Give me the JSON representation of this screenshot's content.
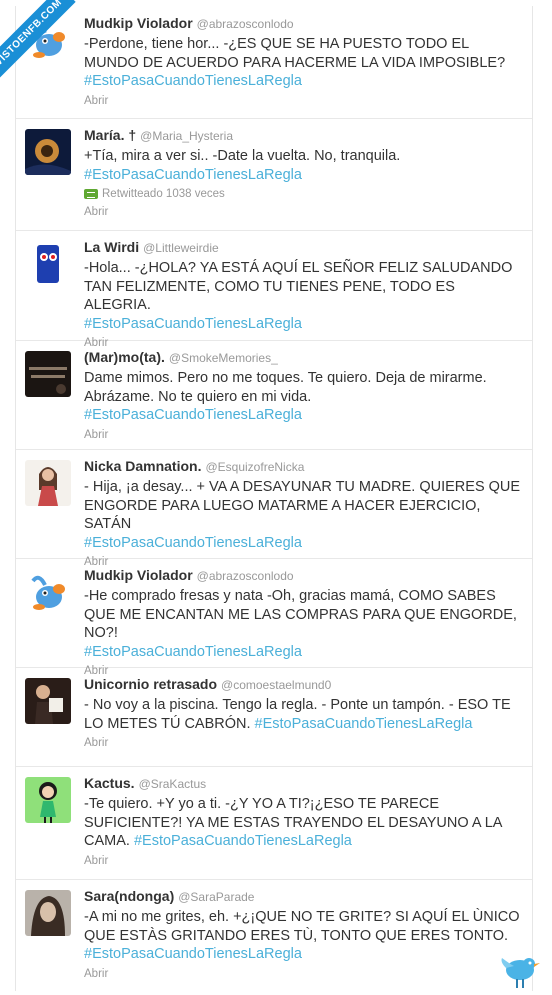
{
  "watermark": "VISTOENFB.COM",
  "tweets": [
    {
      "name": "Mudkip Violador",
      "handle": "@abrazosconlodo",
      "text": "-Perdone, tiene hor... -¿ES QUE SE HA PUESTO TODO EL MUNDO DE ACUERDO PARA HACERME LA VIDA IMPOSIBLE?",
      "hashtag": "#EstoPasaCuandoTienesLaRegla",
      "open": "Abrir"
    },
    {
      "name": "María. †",
      "handle": "@Maria_Hysteria",
      "text": "+Tía, mira a ver si.. -Date la vuelta. No, tranquila.",
      "hashtag": "#EstoPasaCuandoTienesLaRegla",
      "retweet": "Retwitteado 1038 veces",
      "open": "Abrir"
    },
    {
      "name": "La Wirdi",
      "handle": "@Littleweirdie",
      "text": "-Hola... -¿HOLA? YA ESTÁ AQUÍ EL SEÑOR FELIZ SALUDANDO TAN FELIZMENTE, COMO TU TIENES PENE, TODO ES ALEGRIA.",
      "hashtag": "#EstoPasaCuandoTienesLaRegla",
      "open": "Abrir"
    },
    {
      "name": "(Mar)mo(ta).",
      "handle": "@SmokeMemories_",
      "text": "Dame mimos. Pero no me toques. Te quiero. Deja de mirarme. Abrázame. No te quiero en mi vida.",
      "hashtag": "#EstoPasaCuandoTienesLaRegla",
      "open": "Abrir"
    },
    {
      "name": "Nicka Damnation.",
      "handle": "@EsquizofreNicka",
      "text": "- Hija, ¡a desay... + VA A DESAYUNAR TU MADRE. QUIERES QUE ENGORDE PARA LUEGO MATARME A HACER EJERCICIO, SATÁN",
      "hashtag": "#EstoPasaCuandoTienesLaRegla",
      "open": "Abrir"
    },
    {
      "name": "Mudkip Violador",
      "handle": "@abrazosconlodo",
      "text": "-He comprado fresas y nata -Oh, gracias mamá, COMO SABES QUE ME ENCANTAN ME LAS COMPRAS PARA QUE ENGORDE, NO?!",
      "hashtag": "#EstoPasaCuandoTienesLaRegla",
      "open": "Abrir"
    },
    {
      "name": "Unicornio retrasado",
      "handle": "@comoestaelmund0",
      "text": "- No voy a la piscina. Tengo la regla. - Ponte un tampón. - ESO TE LO METES TÚ CABRÓN.",
      "hashtag": "#EstoPasaCuandoTienesLaRegla",
      "open": "Abrir"
    },
    {
      "name": "Kactus.",
      "handle": "@SraKactus",
      "text": "-Te quiero. +Y yo a ti. -¿Y YO A TI?¡¿ESO TE PARECE SUFICIENTE?! YA ME ESTAS TRAYENDO EL DESAYUNO A LA CAMA.",
      "hashtag": "#EstoPasaCuandoTienesLaRegla",
      "open": "Abrir"
    },
    {
      "name": "Sara(ndonga)",
      "handle": "@SaraParade",
      "text": "-A mi no me grites, eh. +¿¡QUE NO TE GRITE? SI AQUÍ EL ÙNICO QUE ESTÀS GRITANDO ERES TÙ, TONTO QUE ERES TONTO.",
      "hashtag": "#EstoPasaCuandoTienesLaRegla",
      "open": "Abrir"
    }
  ]
}
